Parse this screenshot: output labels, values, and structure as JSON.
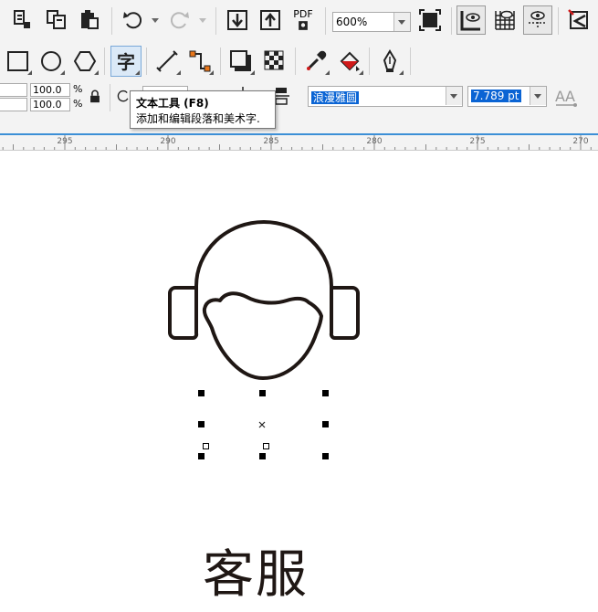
{
  "toolbar": {
    "zoom_value": "600%",
    "pdf_label": "PDF"
  },
  "property_bar": {
    "scale_x": "100.0",
    "scale_y": "100.0",
    "percent_x": "%",
    "percent_y": "%",
    "font_name": "浪漫雅圆",
    "font_size": "7.789 pt"
  },
  "tooltip": {
    "title": "文本工具 (F8)",
    "body": "添加和编辑段落和美术字."
  },
  "ruler": {
    "labels": [
      "295",
      "290",
      "285",
      "280",
      "275",
      "270"
    ]
  },
  "canvas": {
    "text_object": "客服"
  },
  "colors": {
    "accent": "#3c8fd6",
    "selection": "#0a64d4",
    "icon_stroke": "#1f1714"
  }
}
